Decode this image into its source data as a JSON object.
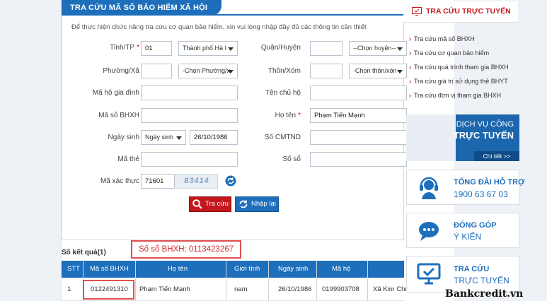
{
  "form": {
    "title": "TRA CỨU MÃ SỐ BẢO HIỂM XÃ HỘI",
    "intro": "Để thực hiện chức năng tra cứu cơ quan bảo hiểm, xin vui lòng nhập đầy đủ các thông tin cần thiết",
    "required_mark": "*",
    "fields": {
      "tinh_label": "Tỉnh/TP",
      "tinh_code": "01",
      "tinh_select": "Thành phố Hà I",
      "quan_label": "Quận/Huyện",
      "quan_select": "--Chọn huyện--",
      "phuong_label": "Phường/Xã",
      "phuong_select": "-Chọn Phường/x",
      "thon_label": "Thôn/Xóm",
      "thon_select": "-Chọn thôn/xón",
      "ma_ho_label": "Mã hộ gia đình",
      "ten_chu_ho_label": "Tên chủ hộ",
      "ma_bhxh_label": "Mã số BHXH",
      "ho_ten_label": "Họ tên",
      "ho_ten_value": "Phạm Tiến Mạnh",
      "ngay_sinh_label": "Ngày sinh",
      "ngay_sinh_select": "Ngày sinh",
      "ngay_sinh_value": "26/10/1986",
      "cmtnd_label": "Số CMTND",
      "ma_the_label": "Mã thẻ",
      "so_so_label": "Số sổ",
      "captcha_label": "Mã xác thực",
      "captcha_value": "71601",
      "captcha_image_text": "83414"
    },
    "buttons": {
      "search": "Tra cứu",
      "reset": "Nhập lại"
    }
  },
  "results": {
    "label": "Số kết quả(1)",
    "annotation": "Số sổ BHXH: 0113423267",
    "columns": [
      "STT",
      "Mã số BHXH",
      "Họ tên",
      "Giới tính",
      "Ngày sinh",
      "Mã hộ",
      ""
    ],
    "rows": [
      [
        "1",
        "0122491310",
        "Phạm Tiến Mạnh",
        "nam",
        "26/10/1986",
        "0199903708",
        "Xã Kim Chu"
      ]
    ]
  },
  "sidebar": {
    "heading": "TRA CỨU TRỰC TUYẾN",
    "items": [
      "Tra cứu mã số BHXH",
      "Tra cứu cơ quan bảo hiểm",
      "Tra cứu quá trình tham gia BHXH",
      "Tra cứu giá trị sử dụng thẻ BHYT",
      "Tra cứu đơn vị tham gia BHXH"
    ],
    "banner_dvc": {
      "line1": "DỊCH VỤ CÔNG",
      "line2": "TRỰC TUYẾN",
      "more": "Chi tiết >>"
    },
    "banner_hotline": {
      "line1": "TỔNG ĐÀI HỖ TRỢ",
      "line2": "1900 63 67 03"
    },
    "banner_feedback": {
      "line1": "ĐÓNG GÓP",
      "line2": "Ý KIẾN"
    },
    "banner_lookup": {
      "line1": "TRA CỨU",
      "line2": "TRỰC TUYẾN"
    }
  },
  "watermark": "Bankcredit.vn",
  "colors": {
    "primary": "#1d6fbc",
    "accent": "#c4171d",
    "highlight": "#e05050"
  }
}
